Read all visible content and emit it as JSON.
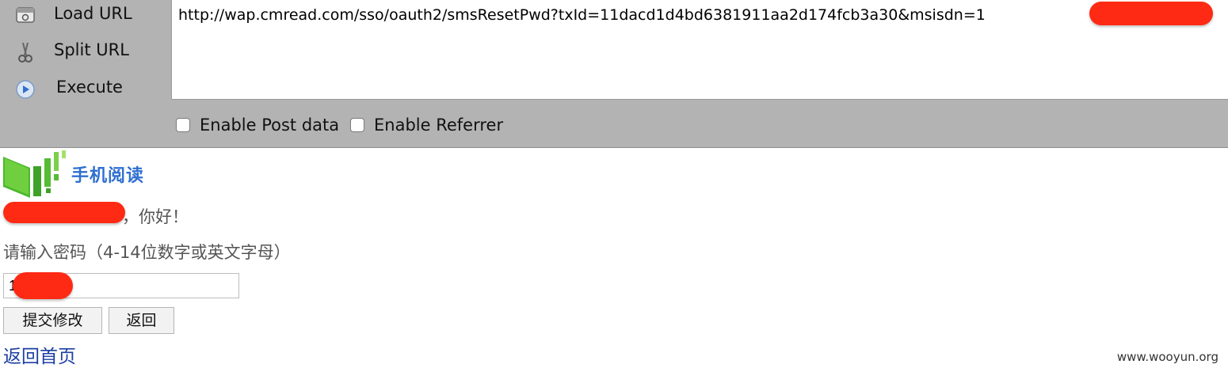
{
  "toolbar": {
    "load_url_label": "Load URL",
    "split_url_label": "Split URL",
    "execute_label": "Execute",
    "url_value": "http://wap.cmread.com/sso/oauth2/smsResetPwd?txId=11dacd1d4bd6381911aa2d174fcb3a30&msisdn=1",
    "enable_post_label": "Enable Post data",
    "enable_referrer_label": "Enable Referrer",
    "icons": {
      "load": "load-url-icon",
      "split": "scissors-icon",
      "execute": "play-icon"
    }
  },
  "page": {
    "logo_text": "手机阅读",
    "greeting_suffix": "，你好！",
    "password_prompt": "请输入密码（4-14位数字或英文字母）",
    "password_value": "1",
    "submit_label": "提交修改",
    "back_label": "返回",
    "home_link": "返回首页"
  },
  "watermark": "www.wooyun.org",
  "colors": {
    "toolbar_bg": "#b3b3b3",
    "redaction": "#ff2a14",
    "link": "#1d3fa3",
    "logo_green": "#3fae2a",
    "logo_blue": "#2f6fd0"
  }
}
